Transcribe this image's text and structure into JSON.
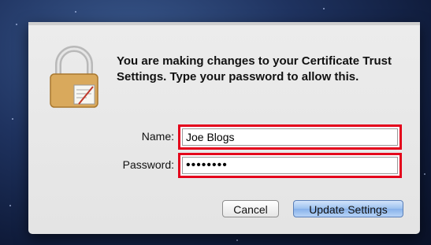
{
  "dialog": {
    "message": "You are making changes to your Certificate Trust Settings. Type your password to allow this.",
    "icon": "lock-icon"
  },
  "form": {
    "name_label": "Name:",
    "name_value": "Joe Blogs",
    "password_label": "Password:",
    "password_value": "••••••••"
  },
  "buttons": {
    "cancel_label": "Cancel",
    "update_label": "Update Settings"
  },
  "colors": {
    "highlight": "#e4001b",
    "default_button": "#9cc1ef"
  }
}
